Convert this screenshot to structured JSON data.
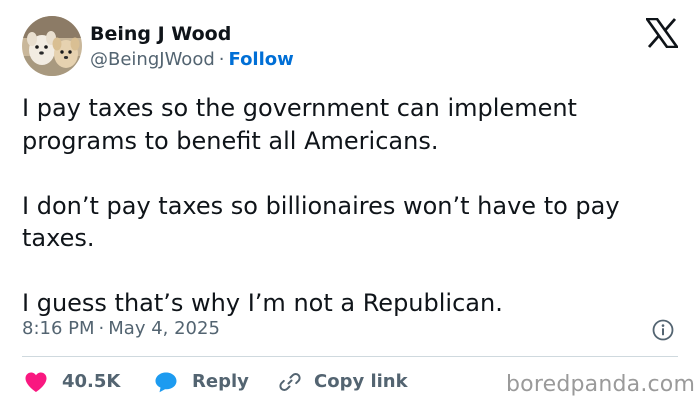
{
  "author": {
    "display_name": "Being J Wood",
    "handle": "@BeingJWood",
    "separator": "·",
    "follow_label": "Follow",
    "avatar_icon": "dogs-avatar"
  },
  "platform_icon": "x-logo-icon",
  "tweet": {
    "paragraphs": [
      "I pay taxes so the government can implement programs to benefit all Americans.",
      "I don’t pay taxes so billionaires won’t have to pay taxes.",
      "I guess that’s why I’m not a Republican."
    ]
  },
  "meta": {
    "time": "8:16 PM",
    "separator": "·",
    "date": "May 4, 2025",
    "info_icon": "info-icon"
  },
  "actions": {
    "like_count": "40.5K",
    "reply_label": "Reply",
    "copy_link_label": "Copy link"
  },
  "watermark": "boredpanda.com",
  "colors": {
    "text": "#0f1419",
    "secondary": "#536471",
    "link": "#006fd6",
    "like": "#f91880",
    "reply": "#1d9bf0",
    "divider": "#cfd9de"
  }
}
